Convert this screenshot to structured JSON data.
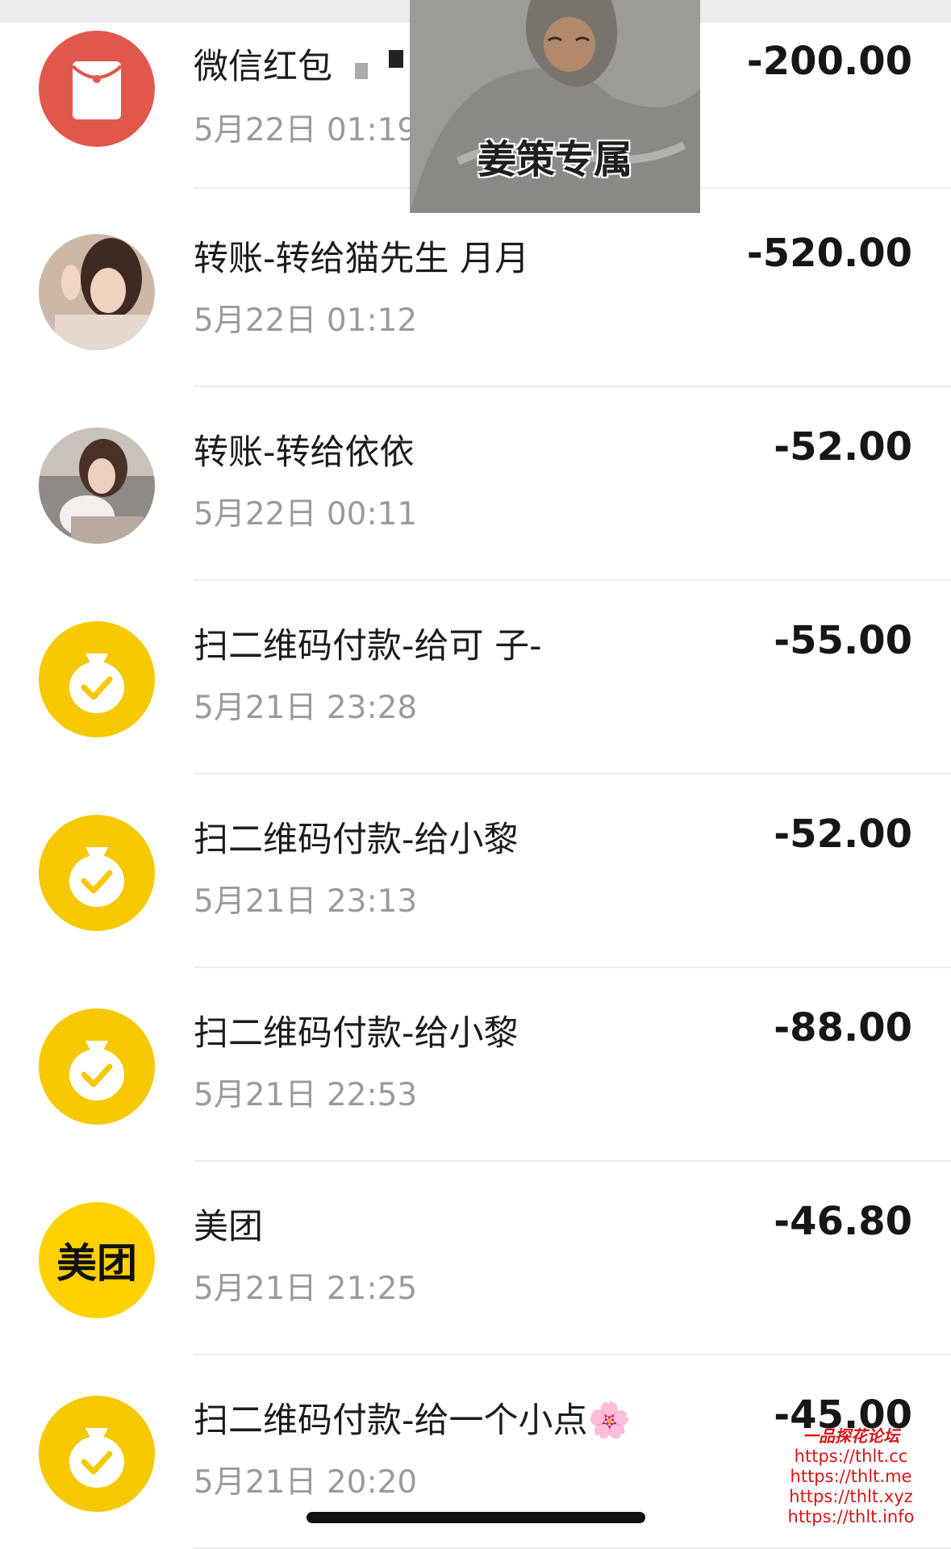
{
  "transactions": [
    {
      "title": "微信红包",
      "time": "5月22日 01:19",
      "amount": "-200.00",
      "icon": "red-packet-icon"
    },
    {
      "title": "转账-转给猫先生 月月",
      "time": "5月22日 01:12",
      "amount": "-520.00",
      "icon": "user-avatar-photo"
    },
    {
      "title": "转账-转给依依",
      "time": "5月22日 00:11",
      "amount": "-52.00",
      "icon": "user-avatar-photo"
    },
    {
      "title": "扫二维码付款-给可 子-",
      "time": "5月21日 23:28",
      "amount": "-55.00",
      "icon": "money-bag-icon"
    },
    {
      "title": "扫二维码付款-给小黎",
      "time": "5月21日 23:13",
      "amount": "-52.00",
      "icon": "money-bag-icon"
    },
    {
      "title": "扫二维码付款-给小黎",
      "time": "5月21日 22:53",
      "amount": "-88.00",
      "icon": "money-bag-icon"
    },
    {
      "title": "美团",
      "time": "5月21日 21:25",
      "amount": "-46.80",
      "icon": "meituan-logo",
      "logo_text": "美团"
    },
    {
      "title": "扫二维码付款-给一个小点",
      "title_emoji": "🌸",
      "time": "5月21日 20:20",
      "amount": "-45.00",
      "icon": "money-bag-icon"
    }
  ],
  "sticker": {
    "caption": "姜策专属"
  },
  "watermark": {
    "title": "一品探花论坛",
    "urls": [
      "https://thlt.cc",
      "https://thlt.me",
      "https://thlt.xyz",
      "https://thlt.info"
    ]
  },
  "colors": {
    "red_packet": "#E2574C",
    "money_bag": "#F5C800",
    "meituan": "#FFD100",
    "amount": "#161616",
    "time": "#9A9A9A",
    "watermark": "#D81414"
  }
}
